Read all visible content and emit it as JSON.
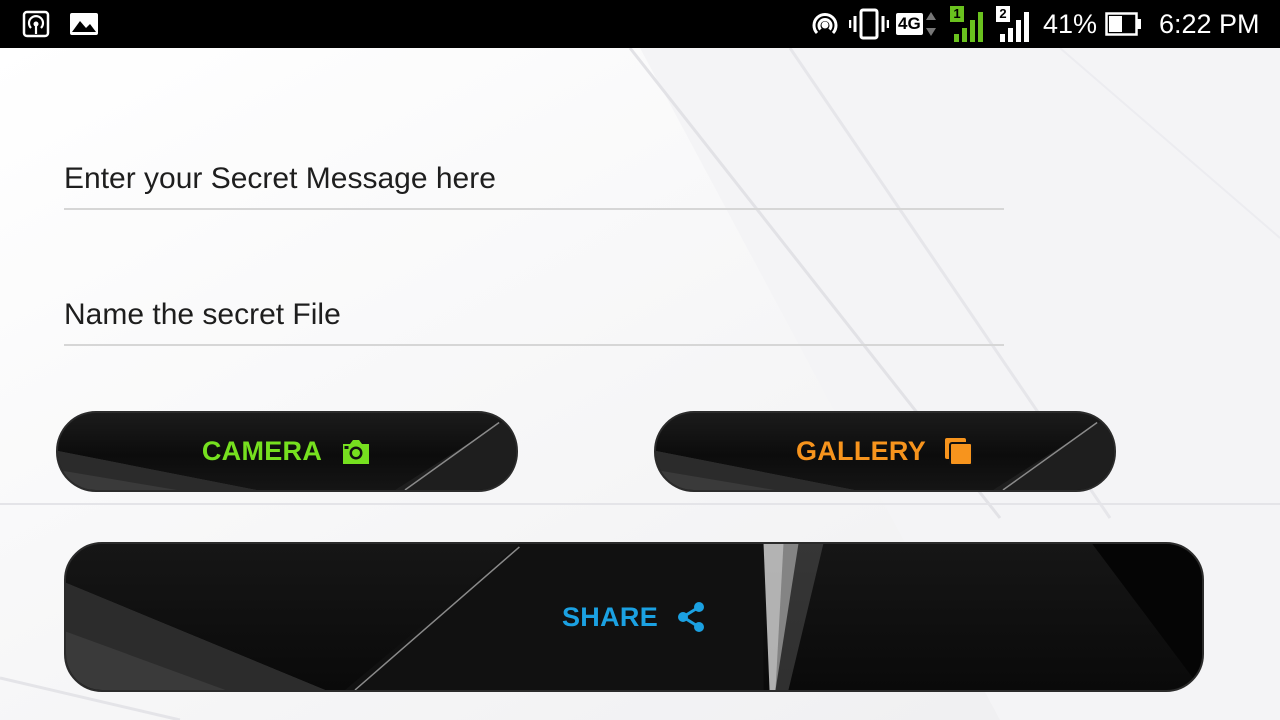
{
  "status_bar": {
    "battery_percent": "41%",
    "time": "6:22 PM",
    "network_type": "4G",
    "sim1_label": "1",
    "sim2_label": "2",
    "icons": [
      "hotspot-icon",
      "image-icon",
      "wifi-hotspot-icon",
      "vibrate-icon",
      "network-4g-icon",
      "signal-sim1-icon",
      "signal-sim2-icon",
      "battery-icon"
    ]
  },
  "form": {
    "message_placeholder": "Enter your Secret Message here",
    "message_value": "",
    "filename_placeholder": "Name the secret File",
    "filename_value": ""
  },
  "buttons": {
    "camera": {
      "label": "CAMERA",
      "color": "#76e01f",
      "icon": "camera-icon"
    },
    "gallery": {
      "label": "GALLERY",
      "color": "#f7941d",
      "icon": "gallery-icon"
    },
    "share": {
      "label": "SHARE",
      "color": "#1ba1e2",
      "icon": "share-icon"
    }
  }
}
